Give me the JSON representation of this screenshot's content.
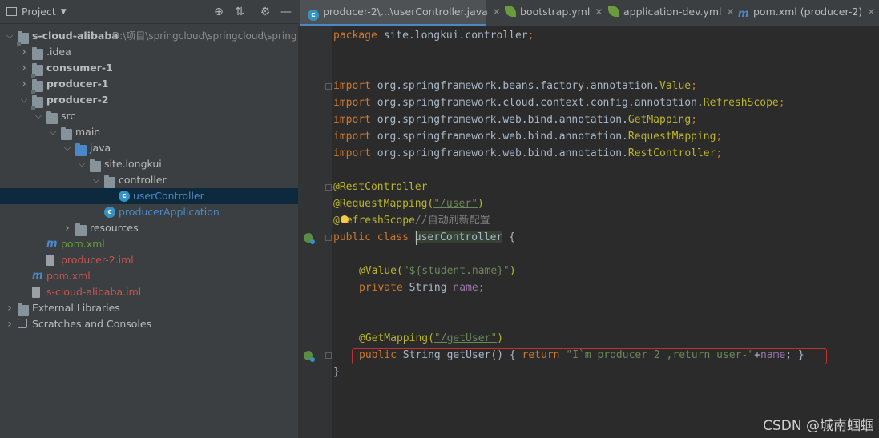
{
  "project_panel": {
    "title": "Project",
    "tree": [
      {
        "label": "s-cloud-alibaba",
        "path": "D:\\项目\\springcloud\\springcloud\\spring",
        "depth": 0,
        "expanded": true,
        "icon": "module-folder",
        "bold": true
      },
      {
        "label": ".idea",
        "depth": 1,
        "expanded": false,
        "icon": "folder"
      },
      {
        "label": "consumer-1",
        "depth": 1,
        "expanded": false,
        "icon": "module-folder",
        "bold": true
      },
      {
        "label": "producer-1",
        "depth": 1,
        "expanded": false,
        "icon": "module-folder",
        "bold": true
      },
      {
        "label": "producer-2",
        "depth": 1,
        "expanded": true,
        "icon": "module-folder",
        "bold": true
      },
      {
        "label": "src",
        "depth": 2,
        "expanded": true,
        "icon": "folder"
      },
      {
        "label": "main",
        "depth": 3,
        "expanded": true,
        "icon": "folder"
      },
      {
        "label": "java",
        "depth": 4,
        "expanded": true,
        "icon": "source-folder"
      },
      {
        "label": "site.longkui",
        "depth": 5,
        "expanded": true,
        "icon": "package"
      },
      {
        "label": "controller",
        "depth": 6,
        "expanded": true,
        "icon": "package"
      },
      {
        "label": "userController",
        "depth": 7,
        "icon": "class",
        "selected": true,
        "color": "#4a88c7"
      },
      {
        "label": "producerApplication",
        "depth": 6,
        "icon": "spring-class",
        "color": "#4a88c7"
      },
      {
        "label": "resources",
        "depth": 4,
        "expanded": false,
        "icon": "resources-folder"
      },
      {
        "label": "pom.xml",
        "depth": 2,
        "icon": "maven",
        "color": "#6a9c3e"
      },
      {
        "label": "producer-2.iml",
        "depth": 2,
        "icon": "iml",
        "color": "#c75450"
      },
      {
        "label": "pom.xml",
        "depth": 1,
        "icon": "maven",
        "color": "#c75450"
      },
      {
        "label": "s-cloud-alibaba.iml",
        "depth": 1,
        "icon": "iml",
        "color": "#c75450"
      },
      {
        "label": "External Libraries",
        "depth": 0,
        "expanded": false,
        "icon": "libraries"
      },
      {
        "label": "Scratches and Consoles",
        "depth": 0,
        "expanded": false,
        "icon": "scratches"
      }
    ]
  },
  "tabs": [
    {
      "label": "producer-2\\...\\userController.java",
      "icon": "class",
      "active": true
    },
    {
      "label": "bootstrap.yml",
      "icon": "spring-leaf"
    },
    {
      "label": "application-dev.yml",
      "icon": "spring-leaf"
    },
    {
      "label": "pom.xml (producer-2)",
      "icon": "maven"
    }
  ],
  "code": {
    "package": {
      "kw": "package ",
      "rest": "site.longkui.controller",
      "semi": ";"
    },
    "imports": [
      {
        "kw": "import ",
        "pkg": "org.springframework.beans.factory.annotation.",
        "cls": "Value"
      },
      {
        "kw": "import ",
        "pkg": "org.springframework.cloud.context.config.annotation.",
        "cls": "RefreshScope"
      },
      {
        "kw": "import ",
        "pkg": "org.springframework.web.bind.annotation.",
        "cls": "GetMapping"
      },
      {
        "kw": "import ",
        "pkg": "org.springframework.web.bind.annotation.",
        "cls": "RequestMapping"
      },
      {
        "kw": "import ",
        "pkg": "org.springframework.web.bind.annotation.",
        "cls": "RestController"
      }
    ],
    "ann_rest": "@RestController",
    "ann_req": "@RequestMapping(",
    "ann_req_arg": "\"/user\"",
    "ann_req_close": ")",
    "ann_refresh_at": "@",
    "ann_refresh": "efreshScope",
    "ann_refresh_comment": "//自动刷新配置",
    "class_kw": "public class ",
    "class_name": "userController",
    "class_open": " {",
    "value_ann": "@Value(",
    "value_arg": "\"${student.name}\"",
    "value_close": ")",
    "field_kw": "private ",
    "field_type": "String ",
    "field_name": "name",
    "field_semi": ";",
    "get_ann": "@GetMapping(",
    "get_arg": "\"/getUser\"",
    "get_close": ")",
    "method_kw": "public ",
    "method_sig": "String getUser() { ",
    "method_return": "return ",
    "method_str": "\"I`m producer 2 ,return user-\"",
    "method_plus": "+",
    "method_field": "name",
    "method_end": "; }",
    "close_brace": "}"
  },
  "watermark": "CSDN @城南蝈蝈"
}
